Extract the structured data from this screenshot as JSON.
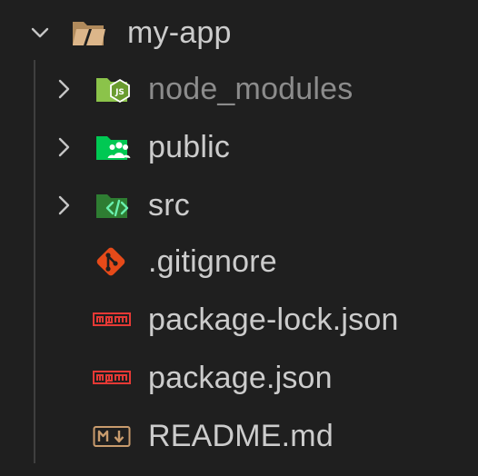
{
  "explorer": {
    "root": {
      "name": "my-app",
      "expanded": true,
      "icon": "folder-open-icon",
      "icon_color": "#d4b184"
    },
    "items": [
      {
        "label": "node_modules",
        "type": "folder",
        "expanded": false,
        "icon": "folder-node-icon",
        "icon_color": "#8bc34a",
        "dimmed": true
      },
      {
        "label": "public",
        "type": "folder",
        "expanded": false,
        "icon": "folder-public-icon",
        "icon_color": "#00c853",
        "dimmed": false
      },
      {
        "label": "src",
        "type": "folder",
        "expanded": false,
        "icon": "folder-src-icon",
        "icon_color": "#2e7d32",
        "dimmed": false
      },
      {
        "label": ".gitignore",
        "type": "file",
        "icon": "git-icon",
        "icon_color": "#e64a19",
        "dimmed": false
      },
      {
        "label": "package-lock.json",
        "type": "file",
        "icon": "npm-icon",
        "icon_color": "#e53935",
        "dimmed": false
      },
      {
        "label": "package.json",
        "type": "file",
        "icon": "npm-icon",
        "icon_color": "#e53935",
        "dimmed": false
      },
      {
        "label": "README.md",
        "type": "file",
        "icon": "markdown-icon",
        "icon_color": "#c89b6d",
        "dimmed": false
      }
    ],
    "colors": {
      "background": "#1f1f1f",
      "text": "#cccccc",
      "text_dimmed": "#8c8c8c",
      "chevron": "#c5c5c5",
      "indent_guide": "#3f3f3f"
    }
  }
}
